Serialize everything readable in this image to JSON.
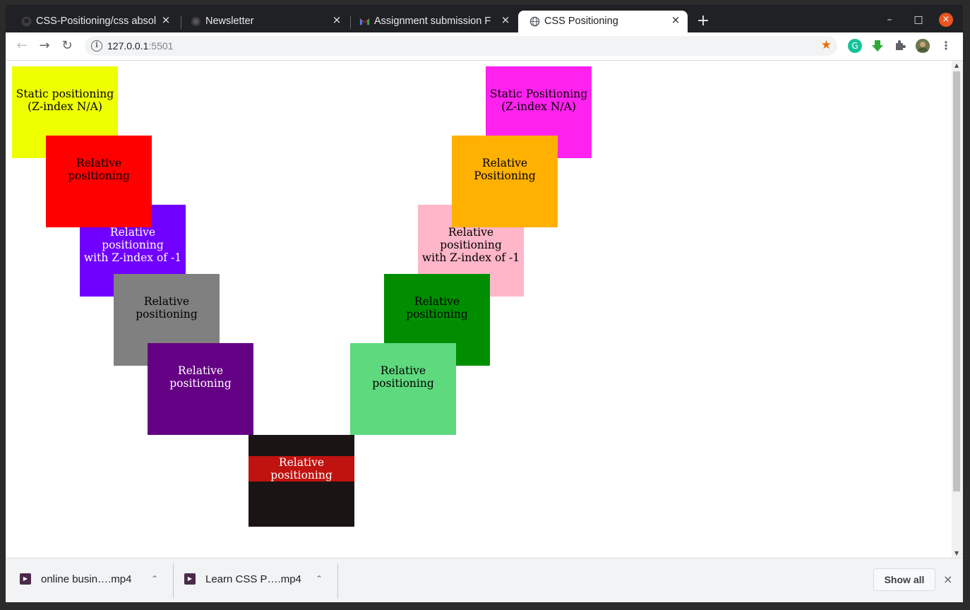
{
  "tabs": [
    {
      "title": "CSS-Positioning/css absol",
      "icon": "github-icon"
    },
    {
      "title": "Newsletter",
      "icon": "globe-icon"
    },
    {
      "title": "Assignment submission F",
      "icon": "gmail-icon"
    },
    {
      "title": "CSS Positioning",
      "icon": "globe-icon",
      "active": true
    }
  ],
  "tab_close_glyph": "×",
  "new_tab_glyph": "+",
  "window_controls": {
    "minimize": "–",
    "maximize": "□",
    "close": "×"
  },
  "toolbar": {
    "back": "←",
    "forward": "→",
    "reload": "↻",
    "url_host": "127.0.0.1",
    "url_port": ":5501",
    "info_glyph": "i",
    "star_glyph": "★",
    "menu_glyph": "⋮"
  },
  "extensions": [
    "grammarly-icon",
    "download-extension-icon",
    "puzzle-icon",
    "profile-avatar"
  ],
  "boxes_left": [
    {
      "lines": [
        "Static positioning",
        "(Z-index N/A)"
      ],
      "bg": "#eeff00",
      "color": "#000000"
    },
    {
      "lines": [
        "Relative positioning"
      ],
      "bg": "#ff0000",
      "color": "#000000"
    },
    {
      "lines": [
        "Relative positioning",
        "with Z-index of -1"
      ],
      "bg": "#7000ff",
      "color": "#ffffff"
    },
    {
      "lines": [
        "Relative positioning"
      ],
      "bg": "#808080",
      "color": "#000000"
    },
    {
      "lines": [
        "Relative positioning"
      ],
      "bg": "#640084",
      "color": "#ffffff"
    }
  ],
  "boxes_right": [
    {
      "lines": [
        "Static Positioning",
        "(Z-index N/A)"
      ],
      "bg": "#ff22ee",
      "color": "#000000"
    },
    {
      "lines": [
        "Relative Positioning"
      ],
      "bg": "#ffb000",
      "color": "#000000"
    },
    {
      "lines": [
        "Relative positioning",
        "with Z-index of -1"
      ],
      "bg": "#ffb6c8",
      "color": "#000000"
    },
    {
      "lines": [
        "Relative positioning"
      ],
      "bg": "#008e00",
      "color": "#000000"
    },
    {
      "lines": [
        "Relative positioning"
      ],
      "bg": "#5ed97e",
      "color": "#000000"
    }
  ],
  "box_bottom": {
    "lines": [
      "Relative positioning"
    ],
    "bg": "#1a1415",
    "color": "#ffffff",
    "highlight": "#c0120f"
  },
  "downloads": {
    "items": [
      {
        "name": "online busin….mp4"
      },
      {
        "name": "Learn CSS P….mp4"
      }
    ],
    "chevron": "⌃",
    "show_all": "Show all",
    "close": "×"
  }
}
